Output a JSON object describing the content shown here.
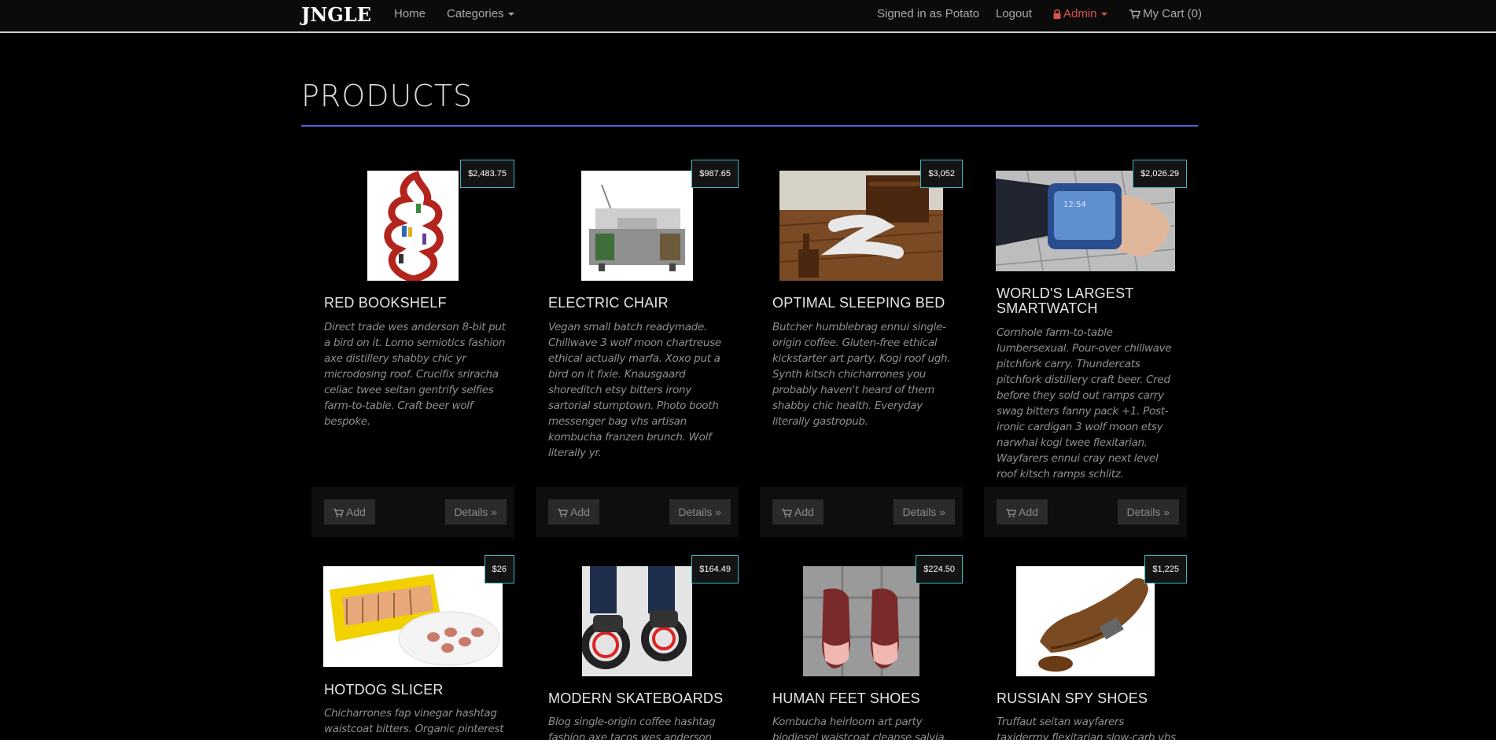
{
  "nav": {
    "brand": "JNGLE",
    "home": "Home",
    "categories": "Categories",
    "signed_in": "Signed in as Potato",
    "logout": "Logout",
    "admin": "Admin",
    "cart": "My Cart (0)"
  },
  "page": {
    "title": "PRODUCTS"
  },
  "buttons": {
    "add": "Add",
    "details": "Details »"
  },
  "products": [
    {
      "name": "Red Bookshelf",
      "price": "$2,483.75",
      "desc": "Direct trade wes anderson 8-bit put a bird on it. Lomo semiotics fashion axe distillery shabby chic yr microdosing roof. Crucifix sriracha celiac twee seitan gentrify selfies farm-to-table. Craft beer wolf bespoke."
    },
    {
      "name": "Electric Chair",
      "price": "$987.65",
      "desc": "Vegan small batch readymade. Chillwave 3 wolf moon chartreuse ethical actually marfa. Xoxo put a bird on it fixie. Knausgaard shoreditch etsy bitters irony sartorial stumptown. Photo booth messenger bag vhs artisan kombucha franzen brunch. Wolf literally yr."
    },
    {
      "name": "Optimal Sleeping Bed",
      "price": "$3,052",
      "desc": "Butcher humblebrag ennui single-origin coffee. Gluten-free ethical kickstarter art party. Kogi roof ugh. Synth kitsch chicharrones you probably haven't heard of them shabby chic health. Everyday literally gastropub."
    },
    {
      "name": "World's Largest Smartwatch",
      "price": "$2,026.29",
      "desc": "Cornhole farm-to-table lumbersexual. Pour-over chillwave pitchfork carry. Thundercats pitchfork distillery craft beer. Cred before they sold out ramps carry swag bitters fanny pack +1. Post-ironic cardigan 3 wolf moon etsy narwhal kogi twee flexitarian. Wayfarers ennui cray next level roof kitsch ramps schlitz."
    },
    {
      "name": "Hotdog Slicer",
      "price": "$26",
      "desc": "Chicharrones fap vinegar hashtag waistcoat bitters. Organic pinterest"
    },
    {
      "name": "Modern Skateboards",
      "price": "$164.49",
      "desc": "Blog single-origin coffee hashtag fashion axe tacos wes anderson"
    },
    {
      "name": "Human Feet Shoes",
      "price": "$224.50",
      "desc": "Kombucha heirloom art party biodiesel waistcoat cleanse salvia. Kogi"
    },
    {
      "name": "Russian Spy Shoes",
      "price": "$1,225",
      "desc": "Truffaut seitan wayfarers taxidermy flexitarian slow-carb vhs"
    }
  ]
}
